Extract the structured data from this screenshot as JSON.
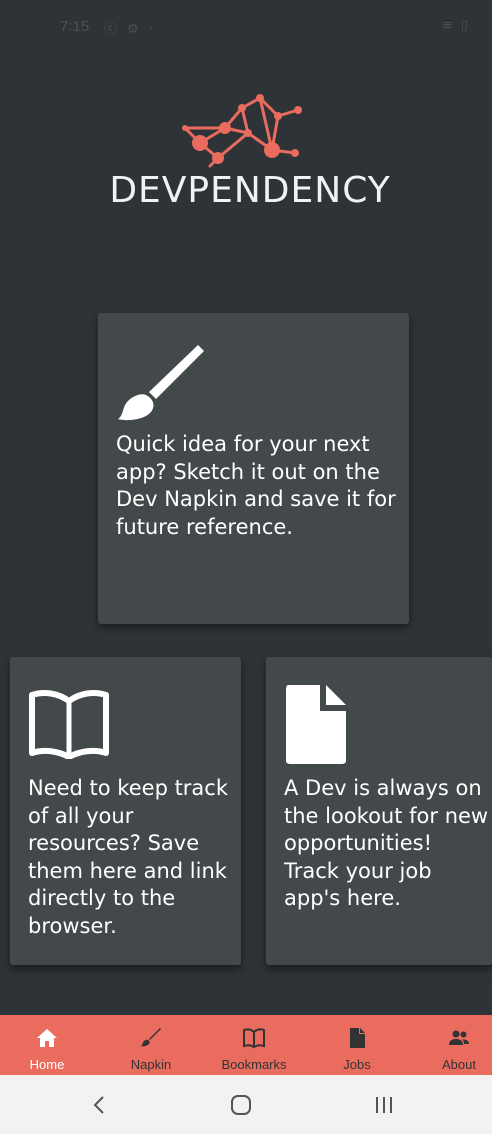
{
  "status_bar": {
    "time": "7:15",
    "left_icons": "ⓒ ⚙ ·",
    "right_icons": "≡ ▯"
  },
  "logo": {
    "text": "DEVPENDENCY",
    "graph_icon": "network-graph-icon",
    "accent": "#e96c5f"
  },
  "cards": {
    "napkin": {
      "icon": "paintbrush-icon",
      "text": "Quick idea for your next app? Sketch it out on the Dev Napkin and save it for future reference."
    },
    "bookmarks": {
      "icon": "open-book-icon",
      "text": "Need to keep track of all your resources? Save them here and link directly to the browser."
    },
    "jobs": {
      "icon": "document-icon",
      "text": "A Dev is always on the lookout for new opportunities! Track your job app's here."
    }
  },
  "bottom_nav": {
    "background": "#e96c5f",
    "items": [
      {
        "label": "Home",
        "icon": "home-icon",
        "active": true
      },
      {
        "label": "Napkin",
        "icon": "brush-icon",
        "active": false
      },
      {
        "label": "Bookmarks",
        "icon": "book-icon",
        "active": false
      },
      {
        "label": "Jobs",
        "icon": "file-icon",
        "active": false
      },
      {
        "label": "About",
        "icon": "people-icon",
        "active": false
      }
    ]
  },
  "system_nav": {
    "back": "back-icon",
    "home": "home-circle-icon",
    "recents": "recents-icon"
  },
  "colors": {
    "background": "#2e3338",
    "card": "#43484a",
    "text": "#ffffff"
  }
}
